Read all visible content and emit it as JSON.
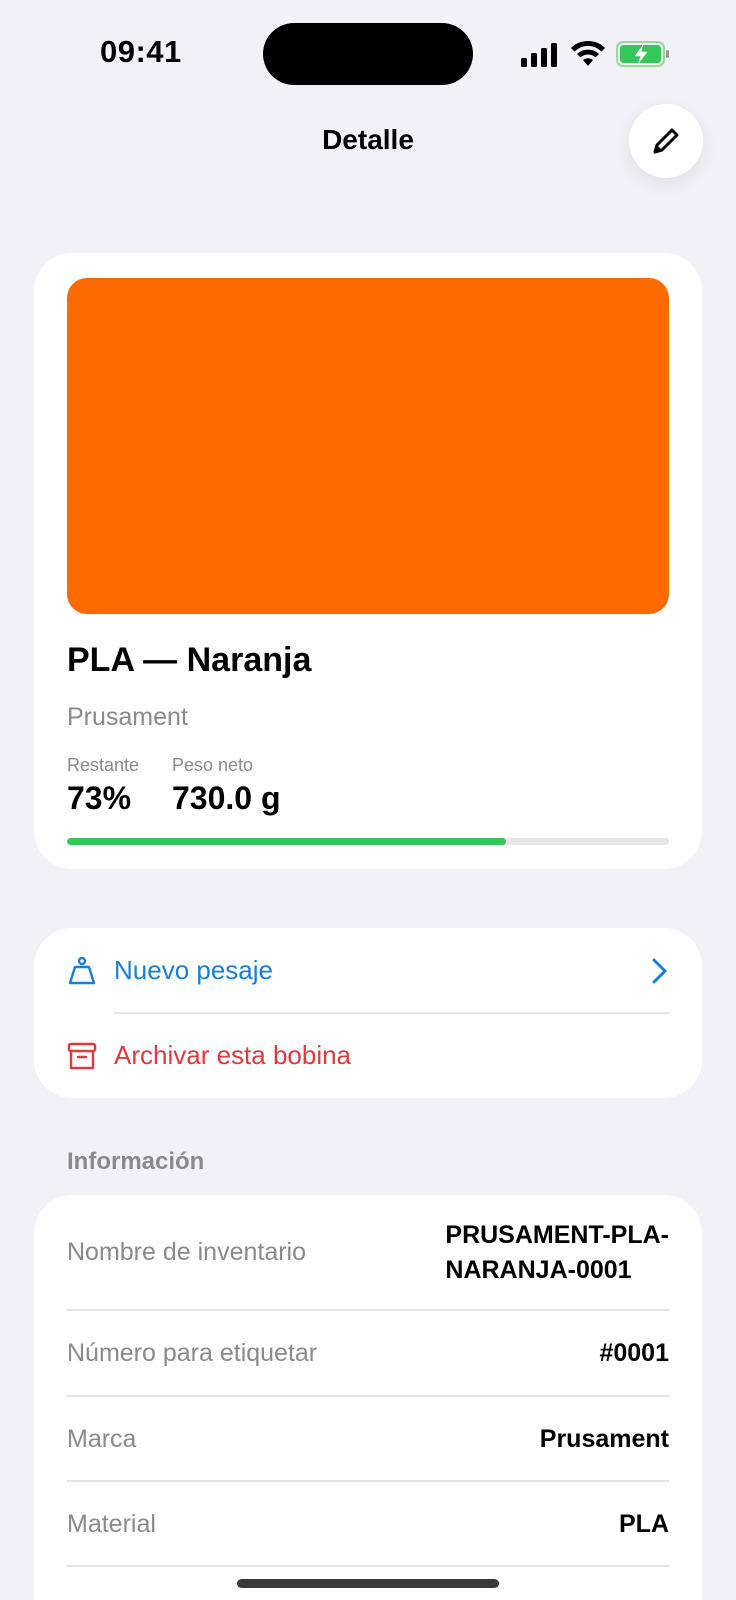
{
  "status_bar": {
    "time": "09:41"
  },
  "nav": {
    "title": "Detalle",
    "edit_icon": "pencil-icon"
  },
  "spool": {
    "color_hex": "#ff6a00",
    "title": "PLA — Naranja",
    "brand": "Prusament",
    "remaining_label": "Restante",
    "remaining_value": "73%",
    "remaining_fraction": 0.73,
    "net_weight_label": "Peso neto",
    "net_weight_value": "730.0 g",
    "progress_color": "#34c759"
  },
  "actions": [
    {
      "label": "Nuevo pesaje",
      "icon": "weight-icon",
      "color": "#1a7fd6"
    },
    {
      "label": "Archivar esta bobina",
      "icon": "archive-icon",
      "color": "#e0393e"
    }
  ],
  "info": {
    "header": "Información",
    "rows": [
      {
        "key": "Nombre de inventario",
        "value_line1": "PRUSAMENT-PLA-",
        "value_line2": "NARANJA-0001"
      },
      {
        "key": "Número para etiquetar",
        "value": "#0001"
      },
      {
        "key": "Marca",
        "value": "Prusament"
      },
      {
        "key": "Material",
        "value": "PLA"
      }
    ]
  }
}
